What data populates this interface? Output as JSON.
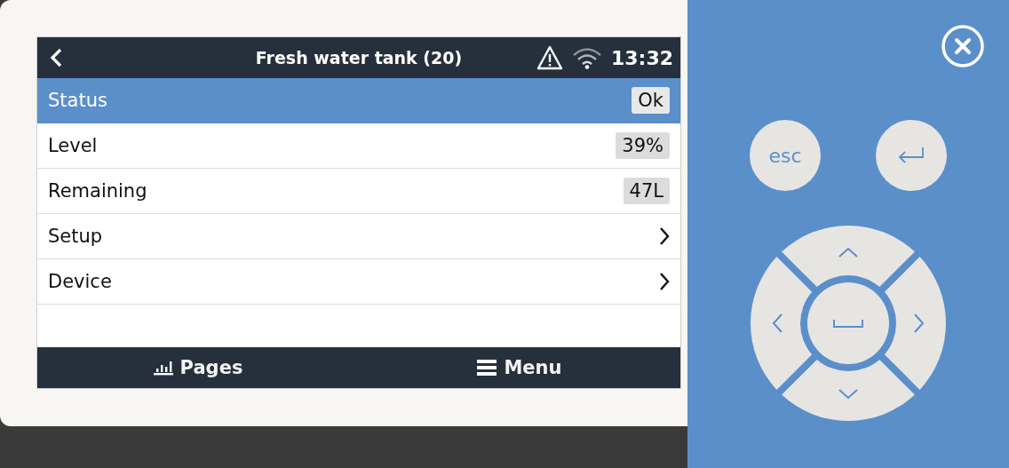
{
  "header": {
    "title": "Fresh water tank (20)",
    "time": "13:32",
    "alarm": true
  },
  "rows": [
    {
      "kind": "value",
      "label": "Status",
      "value": "Ok",
      "selected": true
    },
    {
      "kind": "value",
      "label": "Level",
      "value": "39%",
      "selected": false
    },
    {
      "kind": "value",
      "label": "Remaining",
      "value": "47L",
      "selected": false
    },
    {
      "kind": "link",
      "label": "Setup",
      "selected": false
    },
    {
      "kind": "link",
      "label": "Device",
      "selected": false
    }
  ],
  "footer": {
    "pages": "Pages",
    "menu": "Menu"
  },
  "keypad": {
    "esc": "esc"
  }
}
